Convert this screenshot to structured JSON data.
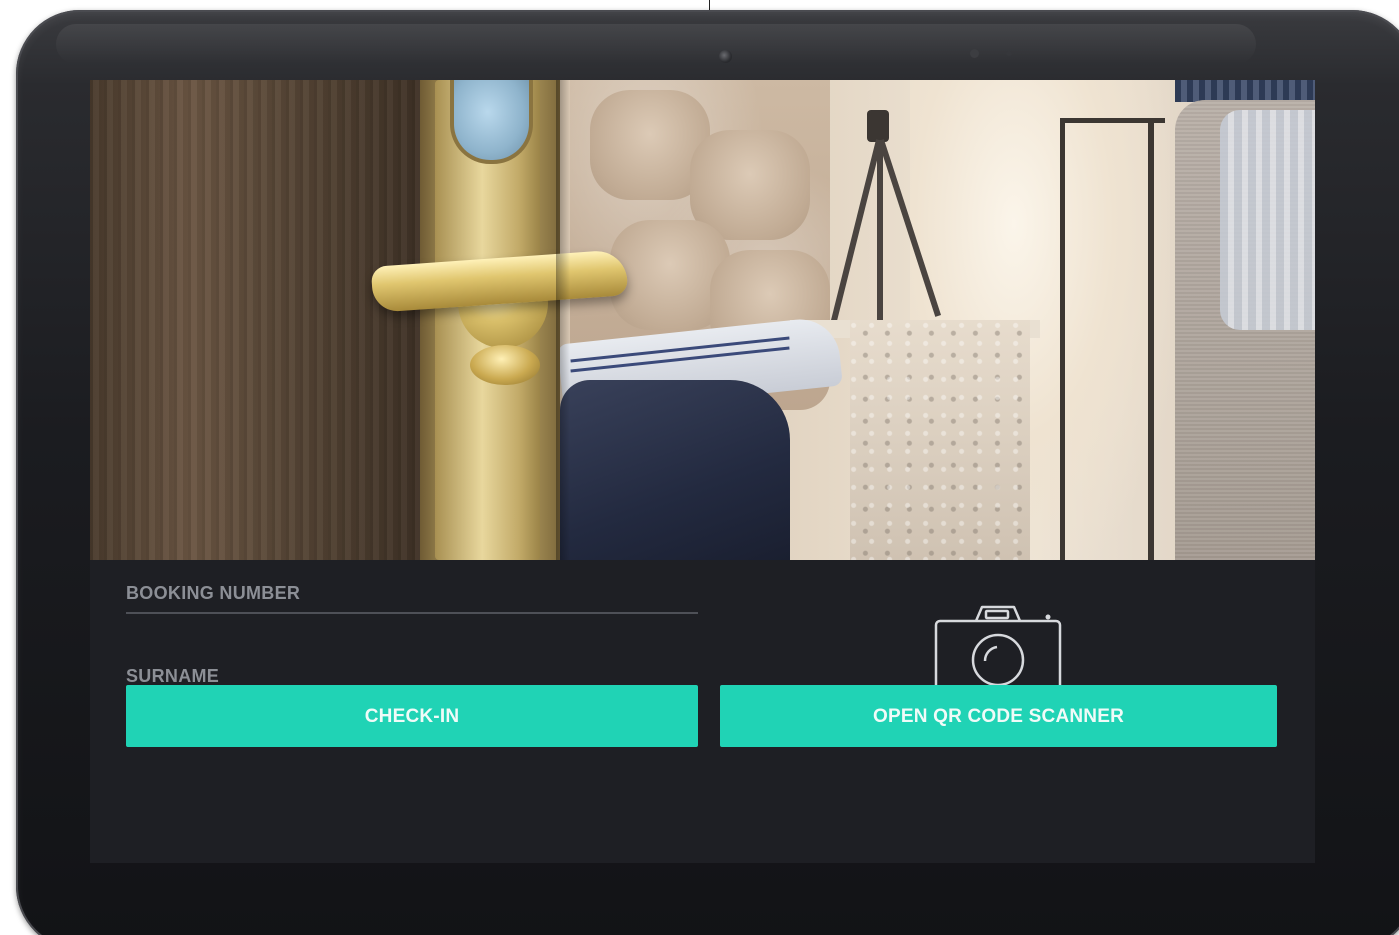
{
  "form": {
    "booking_label": "BOOKING NUMBER",
    "surname_label": "SURNAME"
  },
  "actions": {
    "checkin_label": "CHECK-IN",
    "qr_label": "OPEN QR CODE SCANNER"
  },
  "icons": {
    "camera": "camera-icon"
  },
  "colors": {
    "accent": "#20d3b5",
    "panel": "#1e1f24",
    "label": "#8c8f96"
  }
}
